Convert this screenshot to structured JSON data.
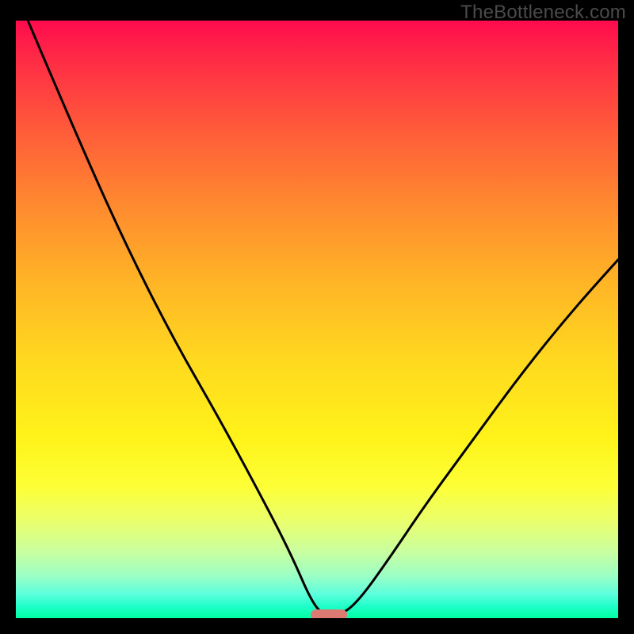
{
  "watermark": "TheBottleneck.com",
  "chart_data": {
    "type": "line",
    "title": "",
    "xlabel": "",
    "ylabel": "",
    "xlim": [
      0,
      100
    ],
    "ylim": [
      0,
      100
    ],
    "series": [
      {
        "name": "curve",
        "x": [
          2,
          10,
          18,
          26,
          34,
          42,
          46,
          49,
          51,
          54,
          57,
          62,
          68,
          76,
          84,
          92,
          100
        ],
        "values": [
          100,
          81,
          63,
          47,
          33,
          18,
          10,
          3,
          0.5,
          0.5,
          3,
          10,
          19,
          30,
          41,
          51,
          60
        ]
      }
    ],
    "marker": {
      "x_start": 49,
      "x_end": 55,
      "y": 0.5
    },
    "colors": {
      "curve": "#000000",
      "marker": "#dd7b73",
      "frame": "#000000"
    }
  }
}
